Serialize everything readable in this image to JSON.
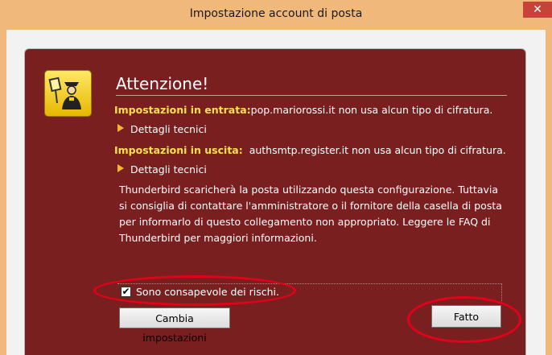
{
  "window": {
    "title": "Impostazione account di posta",
    "close_glyph": "✕",
    "accent_color": "#f0b87a"
  },
  "dialog": {
    "heading": "Attenzione!",
    "icon": "security-shield-icon",
    "incoming": {
      "label": "Impostazioni in entrata:",
      "message": "pop.mariorossi.it non usa alcun tipo di cifratura.",
      "details_label": "Dettagli tecnici"
    },
    "outgoing": {
      "label": "Impostazioni in uscita:",
      "message": "authsmtp.register.it non usa alcun tipo di cifratura.",
      "details_label": "Dettagli tecnici"
    },
    "body": "Thunderbird scaricherà la posta utilizzando questa configurazione. Tuttavia si consiglia di contattare l'amministratore o il fornitore della casella di posta per informarlo di questo collegamento non appropriato. Leggere le FAQ di Thunderbird per maggiori informazioni.",
    "checkbox": {
      "label": "Sono consapevole dei rischi.",
      "checked": true,
      "check_glyph": "✔"
    },
    "change_button": "Cambia impostazioni",
    "done_button": "Fatto",
    "panel_color": "#7a1f20",
    "annotation_color": "#e5001a"
  }
}
